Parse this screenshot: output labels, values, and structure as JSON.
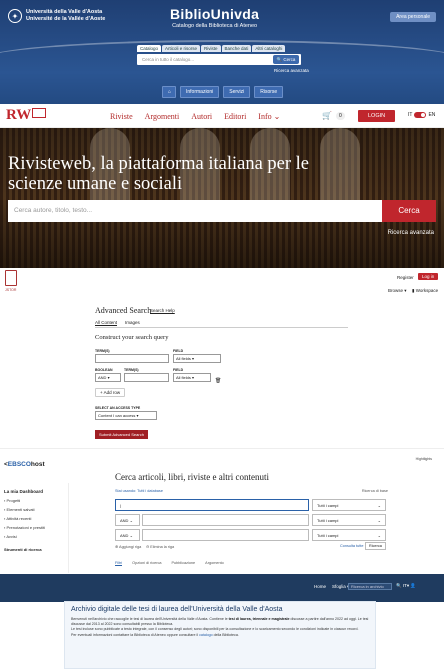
{
  "biblio": {
    "university": [
      "Università della Valle d'Aosta",
      "Université de la Vallée d'Aoste"
    ],
    "brand": "BiblioUnivda",
    "subtitle": "Catalogo della Biblioteca di Ateneo",
    "area_button": "Area personale",
    "tabs": [
      "Catalogo",
      "Articoli e risorse",
      "Riviste",
      "Banche dati",
      "Altri cataloghi"
    ],
    "search_placeholder": "Cerca in tutto il catalogo...",
    "search_button": "Cerca",
    "advanced": "Ricerca avanzata",
    "nav_buttons": [
      "Informazioni",
      "Servizi",
      "Risorse"
    ]
  },
  "rivisteweb": {
    "logo": "RW",
    "menu": [
      "Riviste",
      "Argomenti",
      "Autori",
      "Editori",
      "Info"
    ],
    "cart_count": "0",
    "login": "LOGIN",
    "lang_it": "IT",
    "lang_en": "EN",
    "hero_title": "Rivisteweb, la piattaforma italiana per le scienze umane e sociali",
    "search_placeholder": "Cerca autore, titolo, testo...",
    "search_button": "Cerca",
    "advanced": "Ricerca avanzata"
  },
  "jstor": {
    "register": "Register",
    "login": "Log in",
    "browse": "Browse",
    "workspace": "Workspace",
    "title": "Advanced Search",
    "help": "Search Help",
    "tabs": [
      "All Content",
      "Images"
    ],
    "construct": "Construct your search query",
    "term_label": "TERM(S)",
    "field_label": "FIELD",
    "boolean_label": "BOOLEAN",
    "field_value": "All fields",
    "boolean_value": "AND",
    "add_row": "+ Add row",
    "access_label": "SELECT AN ACCESS TYPE",
    "access_value": "Content I can access",
    "submit": "Submit Advanced Search"
  },
  "ebsco": {
    "logo_prefix": "<",
    "logo_brand": "EBSCO",
    "logo_suffix": "host",
    "top_right": "Hightlights",
    "sidebar_heading": "La mia Dashboard",
    "sidebar_items": [
      "Progetti",
      "Elementi salvati",
      "Attività recenti",
      "Prenotazioni e prestiti",
      "Avvisi"
    ],
    "sidebar_footer": "Strumenti di ricerca",
    "title": "Cerca articoli, libri, riviste e altri contenuti",
    "using": "Stai usando:",
    "using_link": "Tutti i database",
    "tips": "Ricerca di base",
    "field_value": "Tutti i campi",
    "boolean_value": "AND",
    "add_field": "Aggiungi riga",
    "clear": "Elimina la riga",
    "advanced_link": "Consulta tutte",
    "reset": "Ricerca",
    "tabs": [
      "Filtri",
      "Opzioni di ricerca",
      "Pubblicazione",
      "Argomento"
    ]
  },
  "tesi": {
    "links": [
      "Home",
      "Sfoglia"
    ],
    "search_placeholder": "Ricerca in archivio",
    "icons": "IT",
    "heading": "Archivio digitale delle tesi di laurea dell'Università della Valle d'Aosta",
    "p1_a": "Benvenuti nell'archivio che raccoglie le tesi di laurea dell'Università della Valle d'Aosta. Contiene le ",
    "p1_b": "tesi di laurea, triennale e magistrale",
    "p1_c": " discusse a partire dall'anno 2022 ad oggi. Le tesi discusse dal 2013 al 2022 sono consultabili presso la Biblioteca.",
    "p2": "Le tesi incluse sono pubblicate a testo integrale, con il consenso degli autori; sono disponibili per la consultazione e lo scaricamento secondo le condizioni indicate in ciascun record.",
    "p3_a": "Per eventuali informazioni contattare la Biblioteca di Ateneo oppure consultare il ",
    "p3_link": "catalogo",
    "p3_b": " della Biblioteca."
  }
}
